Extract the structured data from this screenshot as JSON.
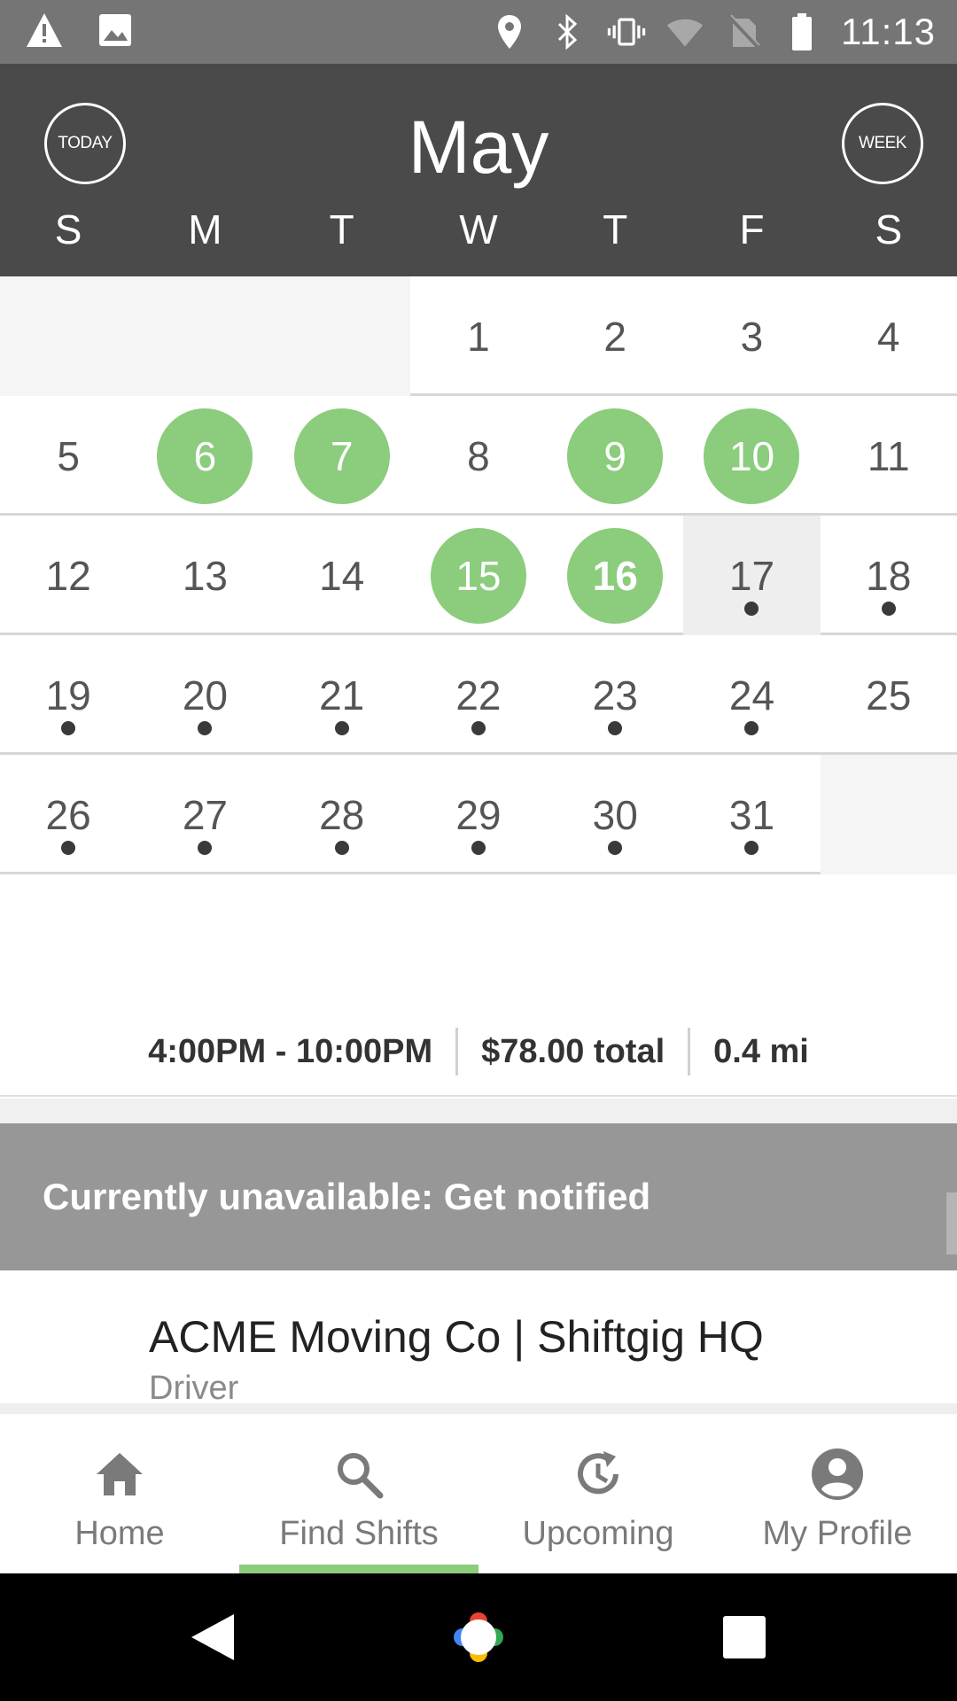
{
  "status_bar": {
    "time": "11:13",
    "left_icons": [
      "warning-icon",
      "image-icon"
    ],
    "right_icons": [
      "location-icon",
      "bluetooth-icon",
      "vibrate-icon",
      "wifi-icon",
      "no-sim-icon",
      "battery-icon"
    ]
  },
  "calendar": {
    "today_label": "TODAY",
    "week_label": "WEEK",
    "month": "May",
    "weekdays": [
      "S",
      "M",
      "T",
      "W",
      "T",
      "F",
      "S"
    ],
    "weeks": [
      [
        null,
        null,
        null,
        {
          "d": "1"
        },
        {
          "d": "2"
        },
        {
          "d": "3"
        },
        {
          "d": "4"
        }
      ],
      [
        {
          "d": "5"
        },
        {
          "d": "6",
          "booked": true
        },
        {
          "d": "7",
          "booked": true
        },
        {
          "d": "8"
        },
        {
          "d": "9",
          "booked": true
        },
        {
          "d": "10",
          "booked": true
        },
        {
          "d": "11"
        }
      ],
      [
        {
          "d": "12"
        },
        {
          "d": "13"
        },
        {
          "d": "14"
        },
        {
          "d": "15",
          "booked": true
        },
        {
          "d": "16",
          "booked": true,
          "bold": true
        },
        {
          "d": "17",
          "today": true,
          "dot": true
        },
        {
          "d": "18",
          "dot": true
        }
      ],
      [
        {
          "d": "19",
          "dot": true
        },
        {
          "d": "20",
          "dot": true
        },
        {
          "d": "21",
          "dot": true
        },
        {
          "d": "22",
          "dot": true
        },
        {
          "d": "23",
          "dot": true
        },
        {
          "d": "24",
          "dot": true
        },
        {
          "d": "25"
        }
      ],
      [
        {
          "d": "26",
          "dot": true
        },
        {
          "d": "27",
          "dot": true
        },
        {
          "d": "28",
          "dot": true
        },
        {
          "d": "29",
          "dot": true
        },
        {
          "d": "30",
          "dot": true
        },
        {
          "d": "31",
          "dot": true
        },
        null
      ]
    ],
    "accent_color": "#8bcc7d"
  },
  "shift_summary": {
    "time_range": "4:00PM - 10:00PM",
    "total": "$78.00 total",
    "distance": "0.4 mi"
  },
  "banner": {
    "text": "Currently unavailable: Get notified"
  },
  "shift_card": {
    "company": "ACME Moving Co | Shiftgig HQ",
    "role": "Driver"
  },
  "bottom_nav": {
    "items": [
      {
        "label": "Home",
        "icon": "home-icon"
      },
      {
        "label": "Find Shifts",
        "icon": "search-icon",
        "active": true
      },
      {
        "label": "Upcoming",
        "icon": "history-icon"
      },
      {
        "label": "My Profile",
        "icon": "profile-icon"
      }
    ]
  }
}
